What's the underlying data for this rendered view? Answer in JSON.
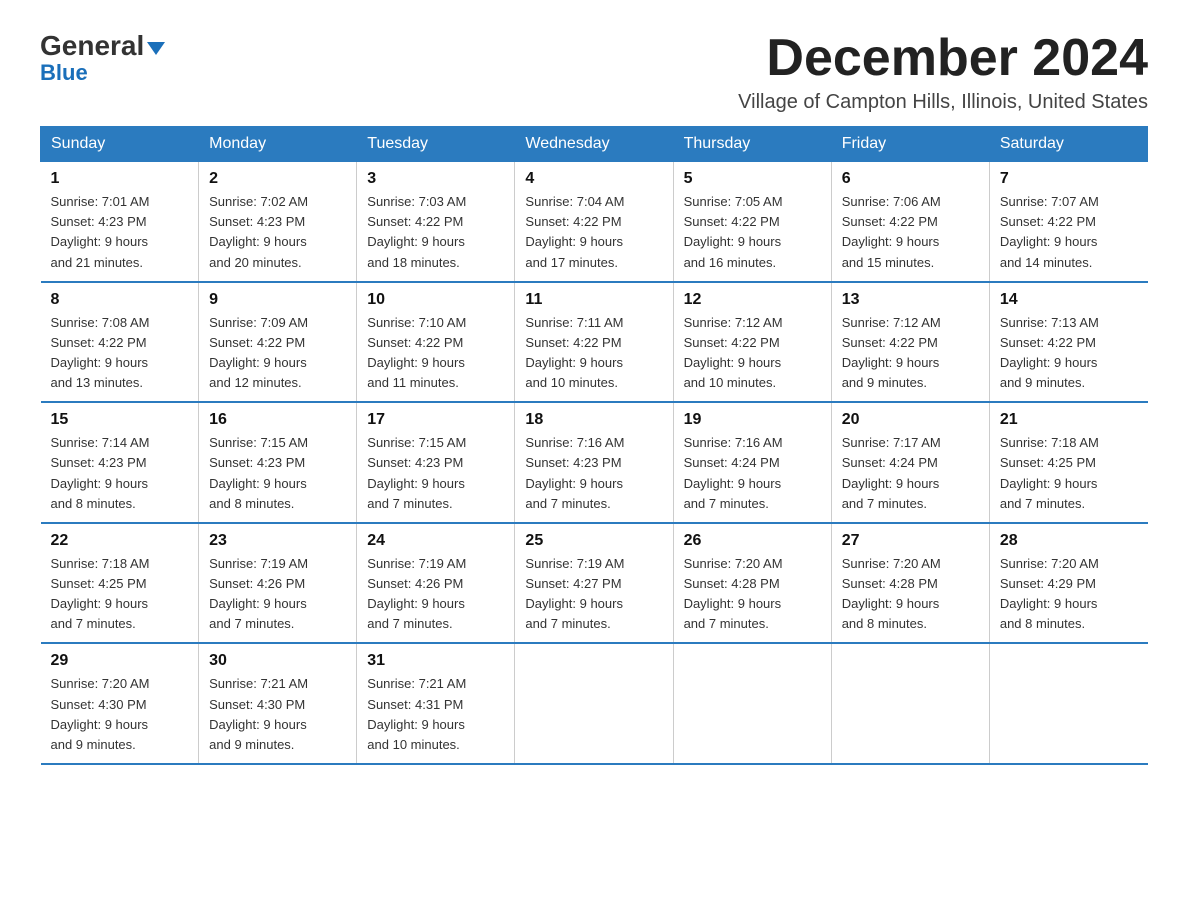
{
  "logo": {
    "general": "General",
    "blue": "Blue",
    "triangle": "▼"
  },
  "header": {
    "month": "December 2024",
    "location": "Village of Campton Hills, Illinois, United States"
  },
  "weekdays": [
    "Sunday",
    "Monday",
    "Tuesday",
    "Wednesday",
    "Thursday",
    "Friday",
    "Saturday"
  ],
  "weeks": [
    [
      {
        "day": "1",
        "sunrise": "7:01 AM",
        "sunset": "4:23 PM",
        "daylight": "9 hours and 21 minutes."
      },
      {
        "day": "2",
        "sunrise": "7:02 AM",
        "sunset": "4:23 PM",
        "daylight": "9 hours and 20 minutes."
      },
      {
        "day": "3",
        "sunrise": "7:03 AM",
        "sunset": "4:22 PM",
        "daylight": "9 hours and 18 minutes."
      },
      {
        "day": "4",
        "sunrise": "7:04 AM",
        "sunset": "4:22 PM",
        "daylight": "9 hours and 17 minutes."
      },
      {
        "day": "5",
        "sunrise": "7:05 AM",
        "sunset": "4:22 PM",
        "daylight": "9 hours and 16 minutes."
      },
      {
        "day": "6",
        "sunrise": "7:06 AM",
        "sunset": "4:22 PM",
        "daylight": "9 hours and 15 minutes."
      },
      {
        "day": "7",
        "sunrise": "7:07 AM",
        "sunset": "4:22 PM",
        "daylight": "9 hours and 14 minutes."
      }
    ],
    [
      {
        "day": "8",
        "sunrise": "7:08 AM",
        "sunset": "4:22 PM",
        "daylight": "9 hours and 13 minutes."
      },
      {
        "day": "9",
        "sunrise": "7:09 AM",
        "sunset": "4:22 PM",
        "daylight": "9 hours and 12 minutes."
      },
      {
        "day": "10",
        "sunrise": "7:10 AM",
        "sunset": "4:22 PM",
        "daylight": "9 hours and 11 minutes."
      },
      {
        "day": "11",
        "sunrise": "7:11 AM",
        "sunset": "4:22 PM",
        "daylight": "9 hours and 10 minutes."
      },
      {
        "day": "12",
        "sunrise": "7:12 AM",
        "sunset": "4:22 PM",
        "daylight": "9 hours and 10 minutes."
      },
      {
        "day": "13",
        "sunrise": "7:12 AM",
        "sunset": "4:22 PM",
        "daylight": "9 hours and 9 minutes."
      },
      {
        "day": "14",
        "sunrise": "7:13 AM",
        "sunset": "4:22 PM",
        "daylight": "9 hours and 9 minutes."
      }
    ],
    [
      {
        "day": "15",
        "sunrise": "7:14 AM",
        "sunset": "4:23 PM",
        "daylight": "9 hours and 8 minutes."
      },
      {
        "day": "16",
        "sunrise": "7:15 AM",
        "sunset": "4:23 PM",
        "daylight": "9 hours and 8 minutes."
      },
      {
        "day": "17",
        "sunrise": "7:15 AM",
        "sunset": "4:23 PM",
        "daylight": "9 hours and 7 minutes."
      },
      {
        "day": "18",
        "sunrise": "7:16 AM",
        "sunset": "4:23 PM",
        "daylight": "9 hours and 7 minutes."
      },
      {
        "day": "19",
        "sunrise": "7:16 AM",
        "sunset": "4:24 PM",
        "daylight": "9 hours and 7 minutes."
      },
      {
        "day": "20",
        "sunrise": "7:17 AM",
        "sunset": "4:24 PM",
        "daylight": "9 hours and 7 minutes."
      },
      {
        "day": "21",
        "sunrise": "7:18 AM",
        "sunset": "4:25 PM",
        "daylight": "9 hours and 7 minutes."
      }
    ],
    [
      {
        "day": "22",
        "sunrise": "7:18 AM",
        "sunset": "4:25 PM",
        "daylight": "9 hours and 7 minutes."
      },
      {
        "day": "23",
        "sunrise": "7:19 AM",
        "sunset": "4:26 PM",
        "daylight": "9 hours and 7 minutes."
      },
      {
        "day": "24",
        "sunrise": "7:19 AM",
        "sunset": "4:26 PM",
        "daylight": "9 hours and 7 minutes."
      },
      {
        "day": "25",
        "sunrise": "7:19 AM",
        "sunset": "4:27 PM",
        "daylight": "9 hours and 7 minutes."
      },
      {
        "day": "26",
        "sunrise": "7:20 AM",
        "sunset": "4:28 PM",
        "daylight": "9 hours and 7 minutes."
      },
      {
        "day": "27",
        "sunrise": "7:20 AM",
        "sunset": "4:28 PM",
        "daylight": "9 hours and 8 minutes."
      },
      {
        "day": "28",
        "sunrise": "7:20 AM",
        "sunset": "4:29 PM",
        "daylight": "9 hours and 8 minutes."
      }
    ],
    [
      {
        "day": "29",
        "sunrise": "7:20 AM",
        "sunset": "4:30 PM",
        "daylight": "9 hours and 9 minutes."
      },
      {
        "day": "30",
        "sunrise": "7:21 AM",
        "sunset": "4:30 PM",
        "daylight": "9 hours and 9 minutes."
      },
      {
        "day": "31",
        "sunrise": "7:21 AM",
        "sunset": "4:31 PM",
        "daylight": "9 hours and 10 minutes."
      },
      null,
      null,
      null,
      null
    ]
  ]
}
